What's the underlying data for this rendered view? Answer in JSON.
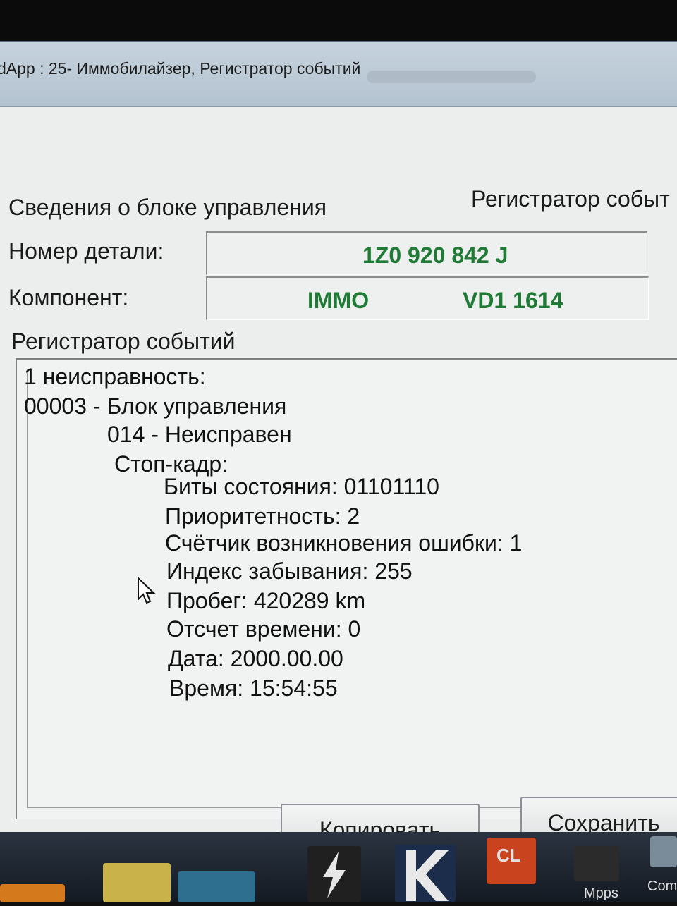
{
  "window": {
    "title": "dApp : 25- Иммобилайзер,  Регистратор событий"
  },
  "header": {
    "section_title": "Сведения о блоке управления",
    "right_title": "Регистратор событ"
  },
  "fields": {
    "part_number_label": "Номер детали:",
    "part_number_value": "1Z0 920 842 J",
    "component_label": "Компонент:",
    "component_name": "IMMO",
    "component_version": "VD1 1614"
  },
  "event_log": {
    "label": "Регистратор событий",
    "lines": [
      "1 неисправность:",
      "00003 - Блок управления",
      "014 - Неисправен",
      "Стоп-кадр:",
      "Биты состояния: 01101110",
      "Приоритетность: 2",
      "Счётчик возникновения ошибки: 1",
      "Индекс забывания: 255",
      "Пробег: 420289 km",
      "Отсчет времени: 0",
      "Дата: 2000.00.00",
      "Время: 15:54:55"
    ]
  },
  "buttons": {
    "copy": "Копировать",
    "save": "Сохранить"
  },
  "taskbar": {
    "items": [
      {
        "icon": "app-icon-orange",
        "label": ""
      },
      {
        "icon": "app-icon-chip",
        "label": ""
      },
      {
        "icon": "app-icon-lightning",
        "label": ""
      },
      {
        "icon": "app-icon-k",
        "label": ""
      },
      {
        "icon": "app-icon-cl",
        "label": "CL"
      },
      {
        "icon": "app-icon-mpps",
        "label": "Mpps"
      },
      {
        "icon": "app-icon-com",
        "label": "Com"
      }
    ]
  }
}
